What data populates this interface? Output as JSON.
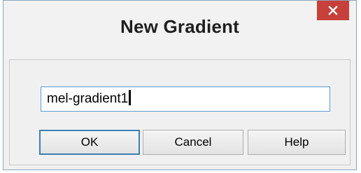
{
  "dialog": {
    "title": "New Gradient",
    "close_icon": "close-icon",
    "name_field": {
      "value": "mel-gradient1"
    },
    "buttons": {
      "ok_label": "OK",
      "cancel_label": "Cancel",
      "help_label": "Help"
    }
  },
  "colors": {
    "close_button_bg": "#c7403a",
    "input_border": "#5b9bd5",
    "default_button_border": "#3c7fb1",
    "dialog_bg": "#f0f0f0"
  }
}
